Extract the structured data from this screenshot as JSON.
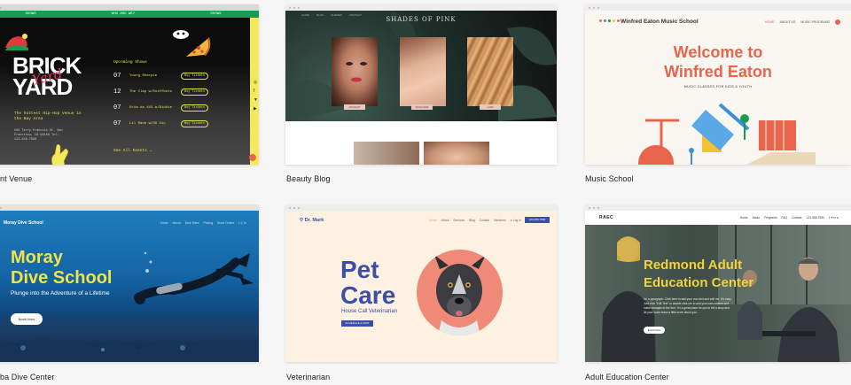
{
  "cards": [
    {
      "caption": "nt Venue",
      "venue": {
        "topbar": [
          "SHOWS",
          "WHO ARE WE?",
          "SHOWS"
        ],
        "logo_line1": "BRICK",
        "logo_line2": "YARD",
        "logo_script": "Yard",
        "tagline": "The hottest Hip-Hop Venue in the Bay Area",
        "address": "500 Terry Francois St. San Francisco, CA 94158 Tel: 123-456-7890",
        "upcoming": "Upcoming Shows",
        "shows": [
          {
            "date": "07",
            "name": "Young Sharpie",
            "ticket": "Buy Tickets"
          },
          {
            "date": "12",
            "name": "The Clap w/Sniffbots",
            "ticket": "Buy Tickets"
          },
          {
            "date": "07",
            "name": "Grim da 415 w/Biddie",
            "ticket": "Buy Tickets"
          },
          {
            "date": "07",
            "name": "Lil Rave w/OG Vic",
            "ticket": "Buy Tickets"
          }
        ],
        "all_events": "See All Events →"
      }
    },
    {
      "caption": "Beauty Blog",
      "beauty": {
        "title": "SHADES OF PINK",
        "nav": [
          "HOME",
          "BLOG",
          "SHADES",
          "CONTACT"
        ],
        "buttons": [
          "MAKEUP",
          "SKINCARE",
          "HAIR"
        ]
      }
    },
    {
      "caption": "Music School",
      "music": {
        "name": "Winfred Eaton Music School",
        "nav": [
          "HOME",
          "ABOUT US",
          "MUSIC PROGRAMS"
        ],
        "welcome_line1": "Welcome to",
        "welcome_line2": "Winfred Eaton",
        "sub": "MUSIC CLASSES FOR KIDS & YOUTH"
      }
    },
    {
      "caption": "ba Dive Center",
      "dive": {
        "logo_letter": "m",
        "name": "Moray Dive School",
        "nav": [
          "Home",
          "About",
          "Dive Sites",
          "Pricing",
          "Book Online"
        ],
        "title_line1": "Moray",
        "title_line2": "Dive School",
        "sub": "Plunge into the Adventure of a Lifetime",
        "button": "Book Now"
      }
    },
    {
      "caption": "Veterinarian",
      "vet": {
        "logo": "Dr. Mark",
        "nav": [
          "Home",
          "About",
          "Services",
          "Blog",
          "Contact",
          "Members"
        ],
        "login": "Log In",
        "book": "123-456-7890",
        "title_line1": "Pet",
        "title_line2": "Care",
        "sub": "House Call Veterinarian",
        "button": "SCHEDULE A VISIT"
      }
    },
    {
      "caption": "Adult Education Center",
      "adult": {
        "logo": "RAEC",
        "nav": [
          "Home",
          "About",
          "Programs",
          "FAQ",
          "Contact",
          "123-456-7890"
        ],
        "title_line1": "Redmond Adult",
        "title_line2": "Education Center",
        "paragraph": "I'm a paragraph. Click here to add your own text and edit me. It's easy. Just click \"Edit Text\" or double click me to add your own content and make changes to the font. I'm a great place for you to tell a story and let your users know a little more about you.",
        "button": "Enroll Now"
      }
    }
  ]
}
